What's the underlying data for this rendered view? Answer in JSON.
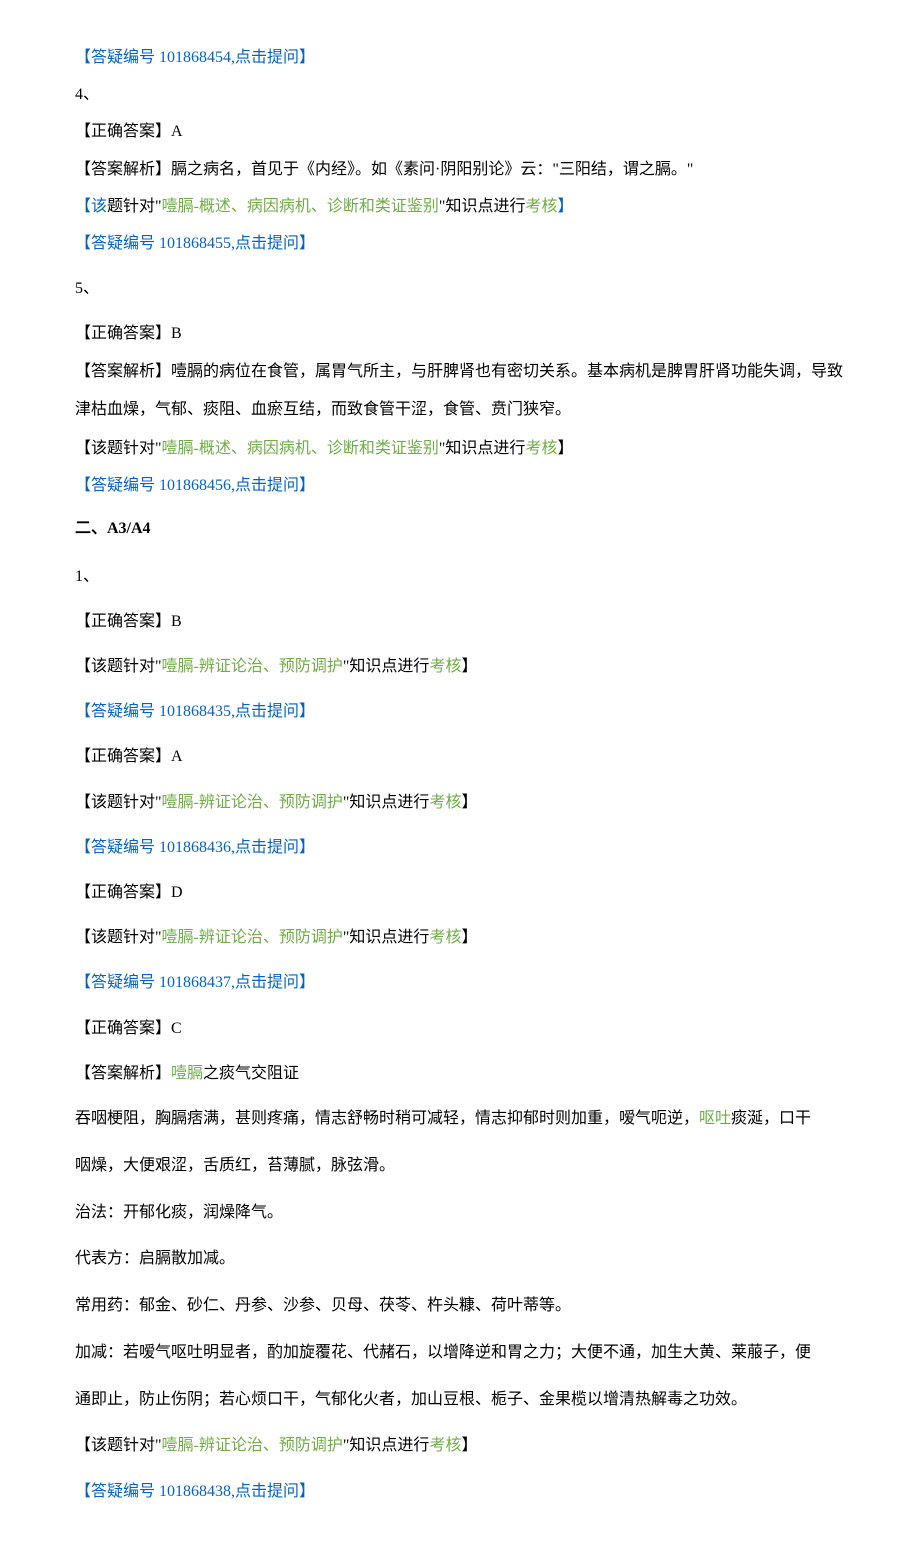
{
  "lines": {
    "l1": "【答疑编号 101868454,点击提问】",
    "l2": "4、",
    "l3": "【正确答案】A",
    "l4": "【答案解析】膈之病名，首见于《内经》。如《素问·阴阳别论》云：\"三阳结，谓之膈。\"",
    "l5_prefix": "【该",
    "l5_mid": "题针对\"",
    "l5_topic": "噎膈-概述、病因病机、诊断和类证鉴别",
    "l5_after_topic": "\"知识点进行",
    "l5_exam": "考核",
    "l5_end": "】",
    "l6": "【答疑编号 101868455,点击提问】",
    "l7": "5、",
    "l8": "【正确答案】B",
    "l9a": "【答案解析】噎膈的病位在食管，属胃气所主，与肝脾肾也有密切关系。基本病机是脾胃肝肾功能失调，导致",
    "l9b": "津枯血燥，气郁、痰阻、血瘀互结，而致食管干涩，食管、贲门狭窄。",
    "l10_prefix": "【该题针对\"",
    "l10_topic": "噎膈-概述、病因病机、诊断和类证鉴别",
    "l10_after_topic": "\"知识点进行",
    "l10_exam": "考核",
    "l10_end": "】",
    "l11": "【答疑编号 101868456,点击提问】",
    "section2": "二、A3/A4",
    "l12": "1、",
    "l13": "【正确答案】B",
    "l14_prefix": "【该题针对\"",
    "l14_topic": "噎膈-辨证论治、预防调护",
    "l14_after_topic": "\"知识点进行",
    "l14_exam": "考核",
    "l14_end": "】",
    "l15": "【答疑编号 101868435,点击提问】",
    "l16": "【正确答案】A",
    "l17_prefix": "【该题针对\"",
    "l17_topic": "噎膈-辨证论治、预防调护",
    "l17_after_topic": "\"知识点进行",
    "l17_exam": "考核",
    "l17_end": "】",
    "l18": "【答疑编号 101868436,点击提问】",
    "l19": "【正确答案】D",
    "l20_prefix": "【该题针对\"",
    "l20_topic": "噎膈-辨证论治、预防调护",
    "l20_after_topic": "\"知识点进行",
    "l20_exam": "考核",
    "l20_end": "】",
    "l21": "【答疑编号 101868437,点击提问】",
    "l22": "【正确答案】C",
    "l23_prefix": "【答案解析】",
    "l23_topic": "噎膈",
    "l23_rest": "之痰气交阻证",
    "l24a_1": "吞咽梗阻，胸膈痞满，甚则疼痛，情志舒畅时稍可减轻，情志抑郁时则加重，嗳气呃逆，",
    "l24a_vomit": "呕吐",
    "l24a_2": "痰涎，口干",
    "l24b": "咽燥，大便艰涩，舌质红，苔薄腻，脉弦滑。",
    "l25": "治法：开郁化痰，润燥降气。",
    "l26": "代表方：启膈散加减。",
    "l27": "常用药：郁金、砂仁、丹参、沙参、贝母、茯苓、杵头糠、荷叶蒂等。",
    "l28a": "加减：若嗳气呕吐明显者，酌加旋覆花、代赭石，以增降逆和胃之力；大便不通，加生大黄、莱菔子，便",
    "l28b": "通即止，防止伤阴；若心烦口干，气郁化火者，加山豆根、栀子、金果榄以增清热解毒之功效。",
    "l29_prefix": "【该题针对\"",
    "l29_topic": "噎膈-辨证论治、预防调护",
    "l29_after_topic": "\"知识点进行",
    "l29_exam": "考核",
    "l29_end": "】",
    "l30": "【答疑编号 101868438,点击提问】"
  }
}
